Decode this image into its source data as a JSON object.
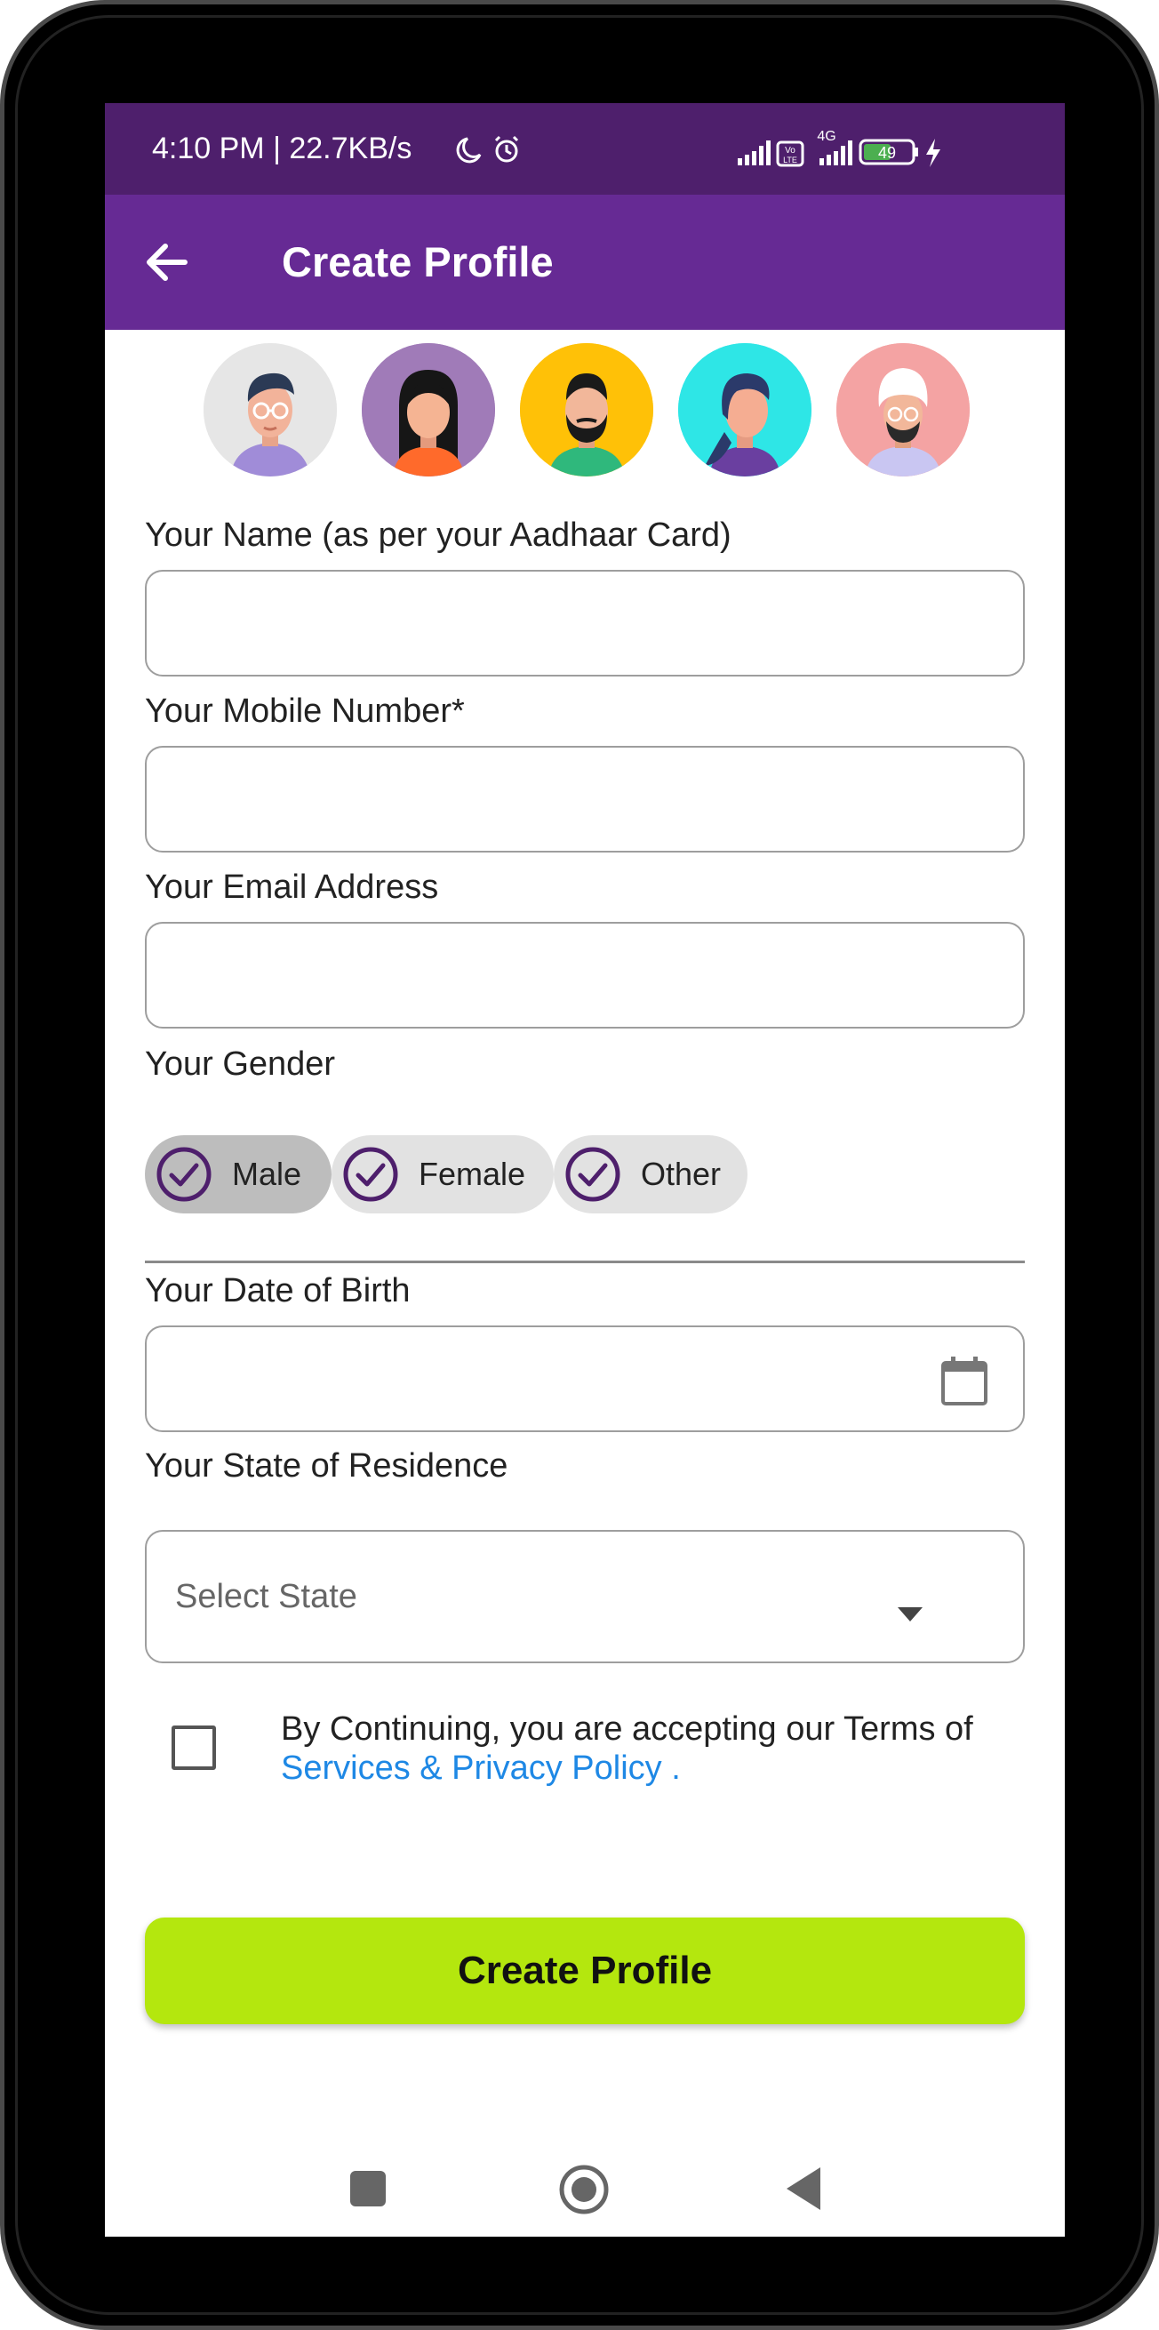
{
  "status": {
    "time": "4:10 PM | 22.7KB/s",
    "battery": "49",
    "network": "4G"
  },
  "appbar": {
    "title": "Create Profile",
    "back_icon": "arrow-left-icon"
  },
  "avatars": [
    {
      "name": "avatar-man-glasses",
      "bg": "#e6e6e6"
    },
    {
      "name": "avatar-woman-long-hair",
      "bg": "#a07bb8"
    },
    {
      "name": "avatar-man-beard",
      "bg": "#ffc107"
    },
    {
      "name": "avatar-woman-ponytail",
      "bg": "#2ee6e6"
    },
    {
      "name": "avatar-man-turban",
      "bg": "#f4a3a3"
    }
  ],
  "form": {
    "name_label": "Your Name (as per your Aadhaar Card)",
    "name_value": "",
    "mobile_label": "Your Mobile Number*",
    "mobile_value": "",
    "email_label": "Your Email Address",
    "email_value": "",
    "gender_label": "Your Gender",
    "gender_options": [
      "Male",
      "Female",
      "Other"
    ],
    "gender_selected": "Male",
    "dob_label": "Your Date of Birth",
    "dob_value": "",
    "state_label": "Your State of Residence",
    "state_placeholder": "Select State",
    "terms_text": "By Continuing, you are accepting our Terms of",
    "terms_link": "Services & Privacy Policy .",
    "terms_checked": false,
    "submit_label": "Create Profile"
  },
  "colors": {
    "status_bar": "#4e1f6c",
    "app_bar": "#662a94",
    "accent_button": "#b4e70e",
    "link": "#1e88e5",
    "check": "#4e1f6c"
  }
}
